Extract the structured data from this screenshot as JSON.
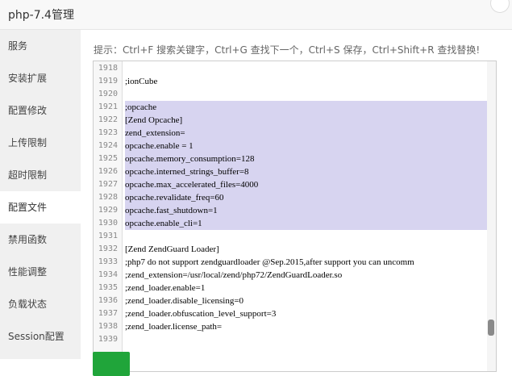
{
  "window": {
    "title": "php-7.4管理"
  },
  "sidebar": {
    "items": [
      {
        "label": "服务"
      },
      {
        "label": "安装扩展"
      },
      {
        "label": "配置修改"
      },
      {
        "label": "上传限制"
      },
      {
        "label": "超时限制"
      },
      {
        "label": "配置文件",
        "active": true
      },
      {
        "label": "禁用函数"
      },
      {
        "label": "性能调整"
      },
      {
        "label": "负载状态"
      },
      {
        "label": "Session配置"
      }
    ]
  },
  "main": {
    "hint": "提示：Ctrl+F 搜索关键字，Ctrl+G 查找下一个，Ctrl+S 保存，Ctrl+Shift+R 查找替换!"
  },
  "editor": {
    "lines": [
      {
        "num": "1918",
        "text": ""
      },
      {
        "num": "1919",
        "text": ";ionCube"
      },
      {
        "num": "1920",
        "text": ""
      },
      {
        "num": "1921",
        "text": ";opcache",
        "selected": true
      },
      {
        "num": "1922",
        "text": "[Zend Opcache]",
        "selected": true
      },
      {
        "num": "1923",
        "text": "zend_extension=",
        "selected": true
      },
      {
        "num": "1924",
        "text": "opcache.enable = 1",
        "selected": true
      },
      {
        "num": "1925",
        "text": "opcache.memory_consumption=128",
        "selected": true
      },
      {
        "num": "1926",
        "text": "opcache.interned_strings_buffer=8",
        "selected": true
      },
      {
        "num": "1927",
        "text": "opcache.max_accelerated_files=4000",
        "selected": true
      },
      {
        "num": "1928",
        "text": "opcache.revalidate_freq=60",
        "selected": true
      },
      {
        "num": "1929",
        "text": "opcache.fast_shutdown=1",
        "selected": true
      },
      {
        "num": "1930",
        "text": "opcache.enable_cli=1",
        "selected": true
      },
      {
        "num": "1931",
        "text": ""
      },
      {
        "num": "1932",
        "text": "[Zend ZendGuard Loader]"
      },
      {
        "num": "1933",
        "text": ";php7 do not support zendguardloader @Sep.2015,after support you can uncomm"
      },
      {
        "num": "1934",
        "text": ";zend_extension=/usr/local/zend/php72/ZendGuardLoader.so"
      },
      {
        "num": "1935",
        "text": ";zend_loader.enable=1"
      },
      {
        "num": "1936",
        "text": ";zend_loader.disable_licensing=0"
      },
      {
        "num": "1937",
        "text": ";zend_loader.obfuscation_level_support=3"
      },
      {
        "num": "1938",
        "text": ";zend_loader.license_path="
      },
      {
        "num": "1939",
        "text": ""
      }
    ]
  },
  "colors": {
    "selection": "#d7d4f0",
    "sidebar_bg": "#f0f0f0",
    "save_button": "#20a53a"
  }
}
